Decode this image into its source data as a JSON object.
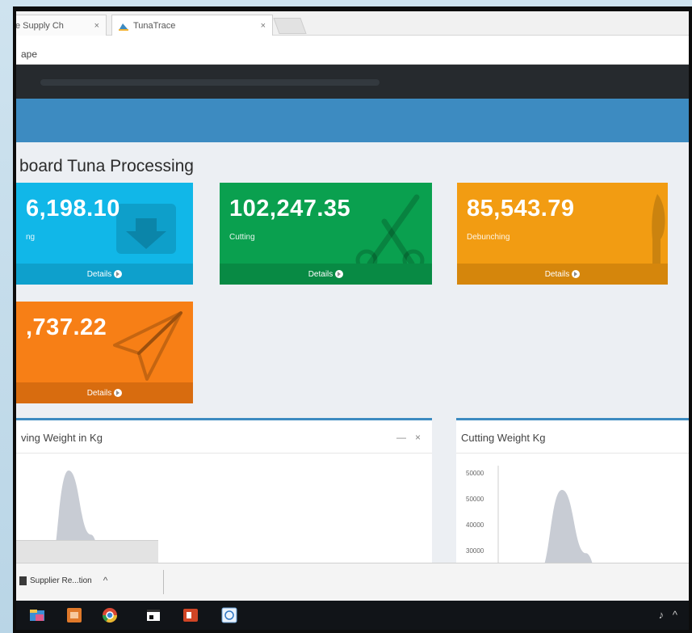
{
  "browser": {
    "tabs": [
      {
        "label": "e Supply Ch",
        "close": "×"
      },
      {
        "label": "TunaTrace",
        "close": "×"
      }
    ],
    "address": "ape"
  },
  "page": {
    "title": "board Tuna Processing"
  },
  "cards": [
    {
      "value": "6,198.10",
      "label": "ng",
      "details": "Details",
      "icon": "download-box-icon",
      "color": "#11b7e8"
    },
    {
      "value": "102,247.35",
      "label": "Cutting",
      "details": "Details",
      "icon": "scissors-icon",
      "color": "#0aa04f"
    },
    {
      "value": "85,543.79",
      "label": "Debunching",
      "details": "Details",
      "icon": "knife-icon",
      "color": "#f29c12"
    },
    {
      "value": ",737.22",
      "label": "",
      "details": "Details",
      "icon": "paper-plane-icon",
      "color": "#f77f16"
    }
  ],
  "panels": {
    "left": {
      "title": "ving Weight in Kg",
      "minimize": "—",
      "close": "×"
    },
    "right": {
      "title": "Cutting Weight Kg"
    }
  },
  "chart_data": [
    {
      "type": "area",
      "title": "ving Weight in Kg",
      "series": [
        {
          "values": [
            0,
            30,
            100,
            60,
            0
          ]
        }
      ]
    },
    {
      "type": "area",
      "title": "Cutting Weight Kg",
      "yticks": [
        "50000",
        "50000",
        "40000",
        "30000"
      ],
      "series": [
        {
          "values": [
            0,
            40,
            100,
            55,
            0
          ]
        }
      ]
    }
  ],
  "downloads": {
    "item_label": "Supplier Re...tion",
    "caret": "^"
  }
}
